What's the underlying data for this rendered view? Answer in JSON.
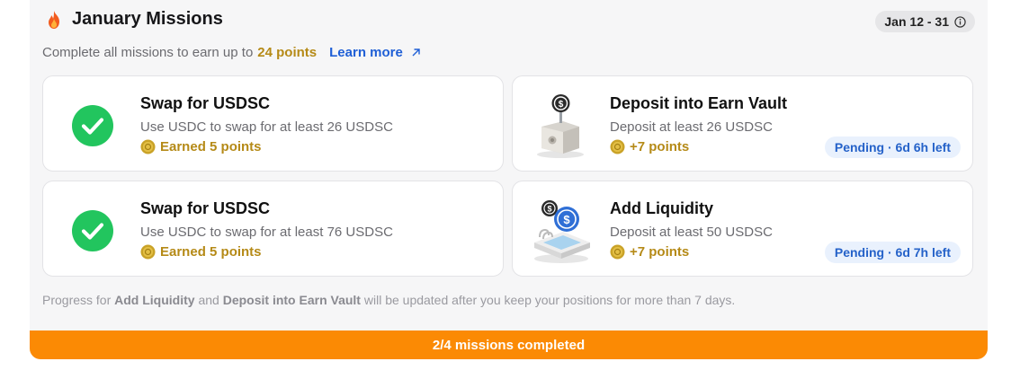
{
  "header": {
    "title": "January Missions",
    "date_range": "Jan 12 - 31"
  },
  "subtitle": {
    "text": "Complete all missions to earn up to",
    "points": "24 points",
    "learn_more": "Learn more"
  },
  "missions": [
    {
      "title": "Swap for USDSC",
      "description": "Use USDC to swap for at least 26 USDSC",
      "points_label": "Earned 5 points",
      "status": "completed"
    },
    {
      "title": "Deposit into Earn Vault",
      "description": "Deposit at least 26 USDSC",
      "points_label": "+7 points",
      "status_label": "Pending · 6d 6h left"
    },
    {
      "title": "Swap for USDSC",
      "description": "Use USDC to swap for at least 76 USDSC",
      "points_label": "Earned 5 points",
      "status": "completed"
    },
    {
      "title": "Add Liquidity",
      "description": "Deposit at least 50 USDSC",
      "points_label": "+7 points",
      "status_label": "Pending · 6d 7h left"
    }
  ],
  "note": {
    "prefix": "Progress for",
    "item1": "Add Liquidity",
    "and": "and",
    "item2": "Deposit into Earn Vault",
    "suffix": "will be updated after you keep your positions for more than 7 days."
  },
  "progress": {
    "label": "2/4 missions completed",
    "completed": 2,
    "total": 4
  },
  "colors": {
    "accent_orange": "#fb8a04",
    "points_gold": "#b58a17",
    "success_green": "#22c55e",
    "link_blue": "#1f5fd6",
    "pending_bg": "#e9f1fd"
  },
  "icons": {
    "header": "fire-icon",
    "date": "info-icon",
    "learn_more": "arrow-up-right-icon",
    "completed": "check-circle-icon",
    "points": "coin-icon",
    "vault": "safe-illustration",
    "liquidity": "pool-illustration"
  }
}
